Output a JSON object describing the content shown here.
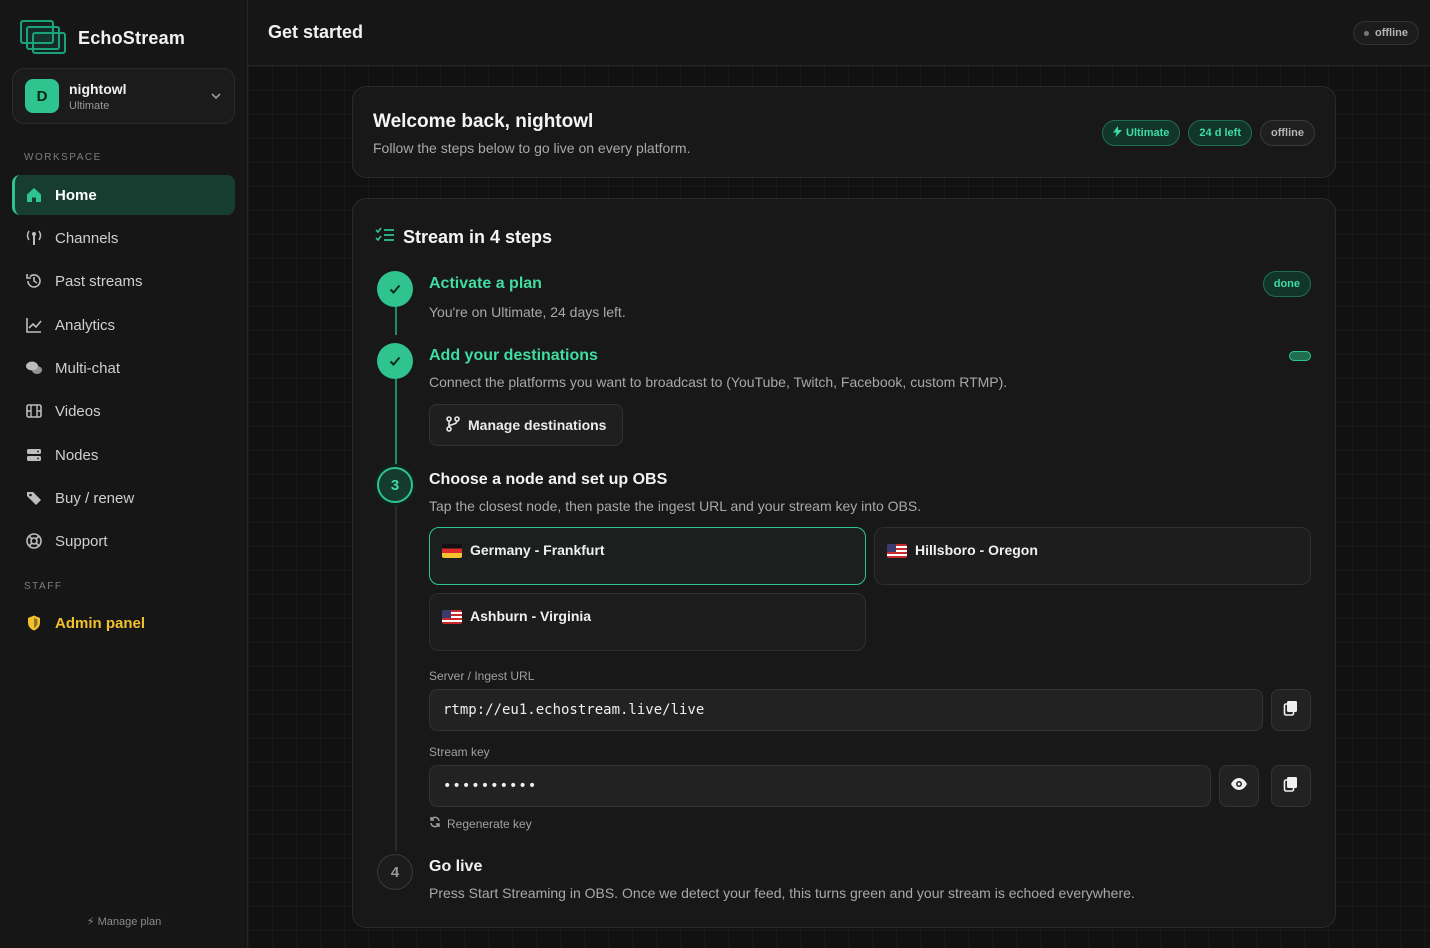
{
  "app": {
    "name": "EchoStream"
  },
  "account": {
    "initial": "D",
    "name": "nightowl",
    "plan": "Ultimate"
  },
  "sidebar": {
    "workspace_label": "WORKSPACE",
    "staff_label": "STAFF",
    "items": [
      {
        "label": "Home",
        "icon": "home-icon"
      },
      {
        "label": "Channels",
        "icon": "antenna-icon"
      },
      {
        "label": "Past streams",
        "icon": "history-icon"
      },
      {
        "label": "Analytics",
        "icon": "chart-line-icon"
      },
      {
        "label": "Multi-chat",
        "icon": "chat-bubbles-icon"
      },
      {
        "label": "Videos",
        "icon": "film-icon"
      },
      {
        "label": "Nodes",
        "icon": "server-icon"
      },
      {
        "label": "Buy / renew",
        "icon": "tags-icon"
      },
      {
        "label": "Support",
        "icon": "lifebuoy-icon"
      }
    ],
    "admin_label": "Admin panel",
    "manage_plan": "⚡ Manage plan"
  },
  "header": {
    "title": "Get started",
    "status": "offline"
  },
  "welcome": {
    "title": "Welcome back, nightowl",
    "subtitle": "Follow the steps below to go live on every platform.",
    "pills": {
      "plan": "Ultimate",
      "days": "24 d left",
      "status": "offline"
    }
  },
  "steps": {
    "title": "Stream in 4 steps",
    "step1": {
      "title": "Activate a plan",
      "desc": "You're on Ultimate, 24 days left.",
      "badge": "done"
    },
    "step2": {
      "title": "Add your destinations",
      "desc": "Connect the platforms you want to broadcast to (YouTube, Twitch, Facebook, custom RTMP).",
      "button": "Manage destinations"
    },
    "step3": {
      "number": "3",
      "title": "Choose a node and set up OBS",
      "desc": "Tap the closest node, then paste the ingest URL and your stream key into OBS.",
      "nodes": [
        {
          "label": "Germany - Frankfurt",
          "selected": true
        },
        {
          "label": "Hillsboro - Oregon",
          "selected": false
        },
        {
          "label": "Ashburn - Virginia",
          "selected": false
        }
      ],
      "server_label": "Server / Ingest URL",
      "server_value": "rtmp://eu1.echostream.live/live",
      "key_label": "Stream key",
      "key_value": "••••••••••",
      "regenerate": "Regenerate key"
    },
    "step4": {
      "number": "4",
      "title": "Go live",
      "desc": "Press Start Streaming in OBS. Once we detect your feed, this turns green and your stream is echoed everywhere."
    }
  },
  "colors": {
    "accent": "#2fc48f",
    "admin": "#f2c12e",
    "background": "#121212"
  }
}
